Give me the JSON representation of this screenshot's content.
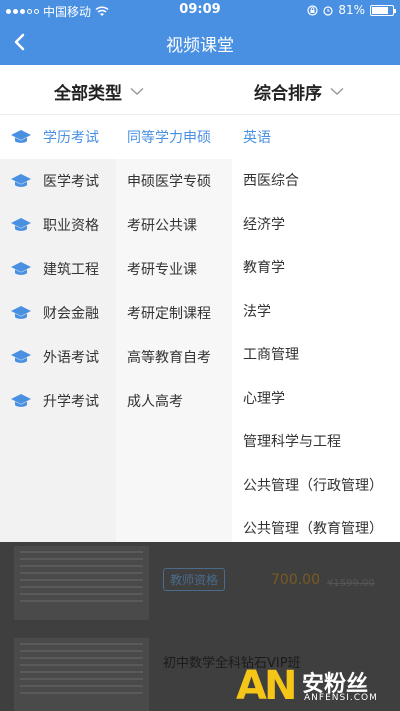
{
  "status_bar": {
    "carrier": "中国移动",
    "time": "09:09",
    "battery": "81%",
    "battery_level": 0.81
  },
  "nav": {
    "title": "视频课堂"
  },
  "filters": {
    "type_label": "全部类型",
    "sort_label": "综合排序"
  },
  "categories": [
    {
      "label": "学历考试",
      "active": true
    },
    {
      "label": "医学考试"
    },
    {
      "label": "职业资格"
    },
    {
      "label": "建筑工程"
    },
    {
      "label": "财会金融"
    },
    {
      "label": "外语考试"
    },
    {
      "label": "升学考试"
    }
  ],
  "subcategories": [
    {
      "label": "同等学力申硕",
      "active": true
    },
    {
      "label": "申硕医学专硕"
    },
    {
      "label": "考研公共课"
    },
    {
      "label": "考研专业课"
    },
    {
      "label": "考研定制课程"
    },
    {
      "label": "高等教育自考"
    },
    {
      "label": "成人高考"
    }
  ],
  "subjects": [
    {
      "label": "英语",
      "active": true
    },
    {
      "label": "西医综合"
    },
    {
      "label": "经济学"
    },
    {
      "label": "教育学"
    },
    {
      "label": "法学"
    },
    {
      "label": "工商管理"
    },
    {
      "label": "心理学"
    },
    {
      "label": "管理科学与工程"
    },
    {
      "label": "公共管理（行政管理）"
    },
    {
      "label": "公共管理（教育管理）"
    }
  ],
  "background_list": {
    "tag": "教师资格",
    "price": "700.00",
    "old_price": "¥1599.00",
    "course_title": "初中数学全科钻石VIP班"
  },
  "watermark": {
    "logo": "AN",
    "cn": "安粉丝",
    "en": "ANFENSI.COM"
  },
  "colors": {
    "accent": "#4a90e2",
    "watermark": "#f5c518"
  }
}
